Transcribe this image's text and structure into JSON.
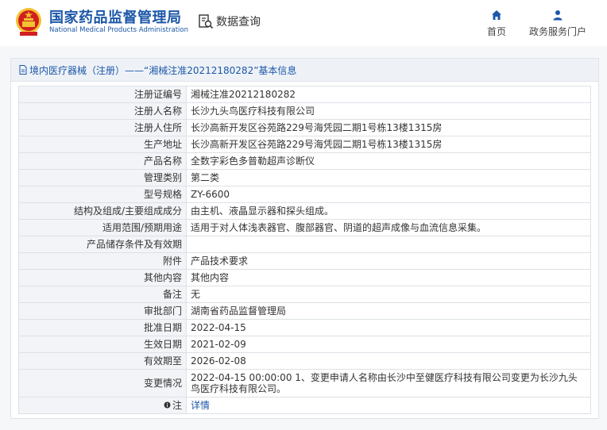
{
  "header": {
    "brand_cn": "国家药品监督管理局",
    "brand_en": "National Medical Products Administration",
    "data_query": "数据查询",
    "nav": {
      "home": "首页",
      "portal": "政务服务门户"
    }
  },
  "colors": {
    "brand_blue": "#1c57a8",
    "emblem_red": "#d21f1f",
    "emblem_gold": "#f2c230"
  },
  "card": {
    "title": "境内医疗器械（注册）——“湘械注准20212180282”基本信息",
    "rows": [
      {
        "key": "注册证编号",
        "value": "湘械注准20212180282"
      },
      {
        "key": "注册人名称",
        "value": "长沙九头鸟医疗科技有限公司"
      },
      {
        "key": "注册人住所",
        "value": "长沙高新开发区谷苑路229号海凭园二期1号栋13楼1315房"
      },
      {
        "key": "生产地址",
        "value": "长沙高新开发区谷苑路229号海凭园二期1号栋13楼1315房"
      },
      {
        "key": "产品名称",
        "value": "全数字彩色多普勒超声诊断仪"
      },
      {
        "key": "管理类别",
        "value": "第二类"
      },
      {
        "key": "型号规格",
        "value": "ZY-6600"
      },
      {
        "key": "结构及组成/主要组成成分",
        "value": "由主机、液晶显示器和探头组成。"
      },
      {
        "key": "适用范围/预期用途",
        "value": "适用于对人体浅表器官、腹部器官、阴道的超声成像与血流信息采集。"
      },
      {
        "key": "产品储存条件及有效期",
        "value": ""
      },
      {
        "key": "附件",
        "value": "产品技术要求"
      },
      {
        "key": "其他内容",
        "value": "其他内容"
      },
      {
        "key": "备注",
        "value": "无"
      },
      {
        "key": "审批部门",
        "value": "湖南省药品监督管理局"
      },
      {
        "key": "批准日期",
        "value": "2022-04-15"
      },
      {
        "key": "生效日期",
        "value": "2021-02-09"
      },
      {
        "key": "有效期至",
        "value": "2026-02-08"
      },
      {
        "key": "变更情况",
        "value": "2022-04-15 00:00:00 1、变更申请人名称由长沙中至健医疗科技有限公司变更为长沙九头鸟医疗科技有限公司。"
      }
    ],
    "note_row": {
      "key": "注",
      "link": "详情"
    }
  }
}
